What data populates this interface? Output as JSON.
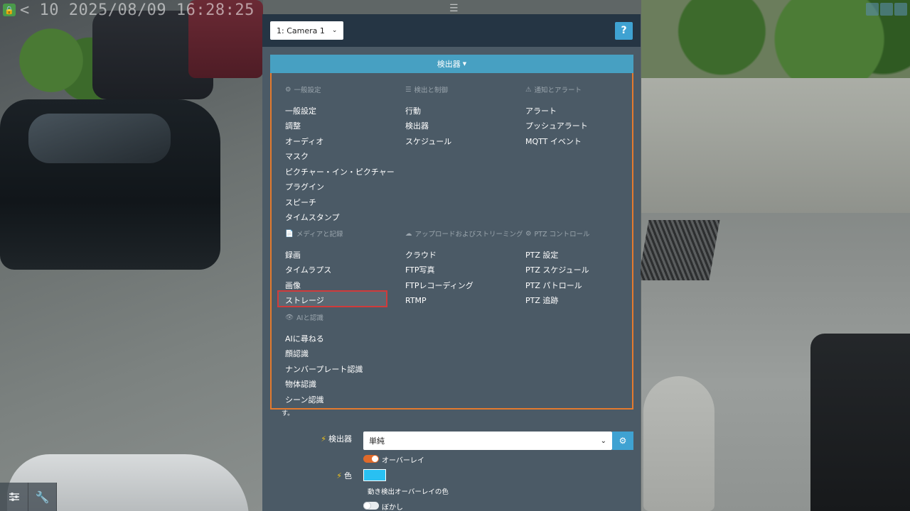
{
  "osd": {
    "timestamp": "< 10 2025/08/09 16:28:25"
  },
  "panel": {
    "camera_select": "1: Camera 1",
    "help_label": "?",
    "detector_bar_label": "検出器",
    "sections": [
      {
        "title": "一般設定",
        "icon": "gears-icon",
        "items": [
          "一般設定",
          "調整",
          "オーディオ",
          "マスク",
          "ピクチャー・イン・ピクチャー",
          "プラグイン",
          "スピーチ",
          "タイムスタンプ"
        ]
      },
      {
        "title": "検出と制御",
        "icon": "list-icon",
        "items": [
          "行動",
          "検出器",
          "スケジュール"
        ]
      },
      {
        "title": "通知とアラート",
        "icon": "warning-icon",
        "items": [
          "アラート",
          "プッシュアラート",
          "MQTT イベント"
        ]
      },
      {
        "title": "メディアと記録",
        "icon": "file-icon",
        "items": [
          "録画",
          "タイムラプス",
          "画像",
          "ストレージ"
        ]
      },
      {
        "title": "アップロードおよびストリーミング",
        "icon": "cloud-icon",
        "items": [
          "クラウド",
          "FTP写真",
          "FTPレコーディング",
          "RTMP"
        ]
      },
      {
        "title": "PTZ コントロール",
        "icon": "gear-icon",
        "items": [
          "PTZ 設定",
          "PTZ スケジュール",
          "PTZ パトロール",
          "PTZ 追跡"
        ]
      },
      {
        "title": "AIと認識",
        "icon": "eye-icon",
        "items": [
          "AIに尋ねる",
          "顔認識",
          "ナンバープレート認識",
          "物体認識",
          "シーン認識"
        ]
      }
    ],
    "selected_item": "ストレージ",
    "trailing_text": "す。",
    "form": {
      "detector_label": "検出器",
      "detector_value": "単純",
      "overlay_label": "オーバーレイ",
      "overlay_on": true,
      "color_label": "色",
      "color_value": "#29c0f2",
      "color_desc": "動き検出オーバーレイの色",
      "blur_label": "ぼかし",
      "blur_on": false
    }
  },
  "toolbar": {
    "sliders_icon": "sliders-icon",
    "wrench_icon": "wrench-icon"
  },
  "colors": {
    "accent": "#47a0c2",
    "highlight": "#e47a2e",
    "selection": "#d13b3b"
  }
}
